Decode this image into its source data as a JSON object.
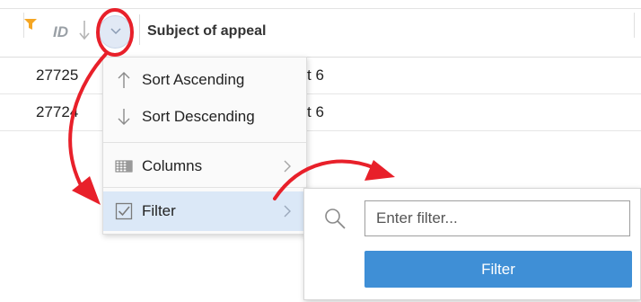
{
  "header": {
    "id_label": "ID",
    "subject_label": "Subject of appeal"
  },
  "rows": [
    {
      "id": "27725",
      "tail": "t 6"
    },
    {
      "id": "27724",
      "tail": "t 6"
    }
  ],
  "menu": {
    "sort_asc": "Sort Ascending",
    "sort_desc": "Sort Descending",
    "columns": "Columns",
    "filter": "Filter"
  },
  "filter_popup": {
    "placeholder": "Enter filter...",
    "value": "",
    "button_label": "Filter"
  },
  "icons": {
    "header_filter": "filter-funnel-icon",
    "header_sort": "sort-down-arrow-icon",
    "header_menu": "chevron-down-icon",
    "sort_asc": "arrow-up-icon",
    "sort_desc": "arrow-down-icon",
    "columns": "columns-grid-icon",
    "filter": "checkbox-checked-icon",
    "submenu": "chevron-right-icon",
    "search": "search-icon"
  },
  "colors": {
    "filter_mark": "#f5a623",
    "menu_highlight": "#dbe8f7",
    "button": "#3f8fd6",
    "annotation": "#e8202a"
  }
}
